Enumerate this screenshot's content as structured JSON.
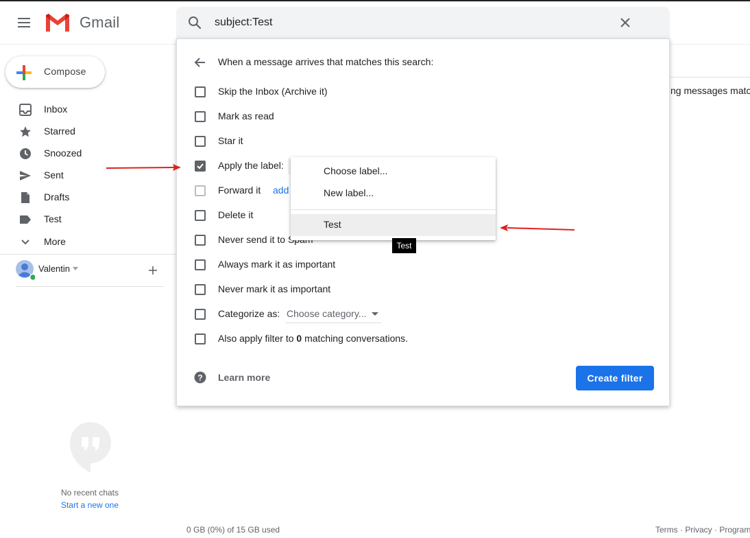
{
  "header": {
    "app_name": "Gmail"
  },
  "search": {
    "query": "subject:Test"
  },
  "sidebar": {
    "compose_label": "Compose",
    "items": [
      {
        "label": "Inbox",
        "icon": "inbox-icon"
      },
      {
        "label": "Starred",
        "icon": "star-icon"
      },
      {
        "label": "Snoozed",
        "icon": "clock-icon"
      },
      {
        "label": "Sent",
        "icon": "send-icon"
      },
      {
        "label": "Drafts",
        "icon": "draft-icon"
      },
      {
        "label": "Test",
        "icon": "label-icon"
      },
      {
        "label": "More",
        "icon": "chevron-down-icon"
      }
    ],
    "account_name": "Valentin",
    "no_chats": "No recent chats",
    "start_chat": "Start a new one"
  },
  "filter": {
    "heading": "When a message arrives that matches this search:",
    "options": [
      {
        "label": "Skip the Inbox (Archive it)",
        "checked": false
      },
      {
        "label": "Mark as read",
        "checked": false
      },
      {
        "label": "Star it",
        "checked": false
      },
      {
        "label": "Apply the label:",
        "checked": true
      },
      {
        "label": "Forward it",
        "checked": false,
        "disabled": true
      },
      {
        "label": "Delete it",
        "checked": false
      },
      {
        "label": "Never send it to Spam",
        "checked": false
      },
      {
        "label": "Always mark it as important",
        "checked": false
      },
      {
        "label": "Never mark it as important",
        "checked": false
      },
      {
        "label": "Categorize as:",
        "checked": false
      },
      {
        "label_before": "Also apply filter to ",
        "count": "0",
        "label_after": " matching conversations.",
        "checked": false
      }
    ],
    "forward_link": "add",
    "category_placeholder": "Choose category...",
    "learn_more": "Learn more",
    "create_button": "Create filter"
  },
  "label_dropdown": {
    "items": [
      "Choose label...",
      "New label...",
      "Test"
    ],
    "highlighted": "Test",
    "tooltip": "Test"
  },
  "background": {
    "match_text": "ng messages matc"
  },
  "footer": {
    "storage": "0 GB (0%) of 15 GB used",
    "links": "Terms · Privacy · Program"
  },
  "colors": {
    "primary_blue": "#1a73e8",
    "annotation_red": "#e0201e",
    "gmail_red": "#ea4335"
  }
}
